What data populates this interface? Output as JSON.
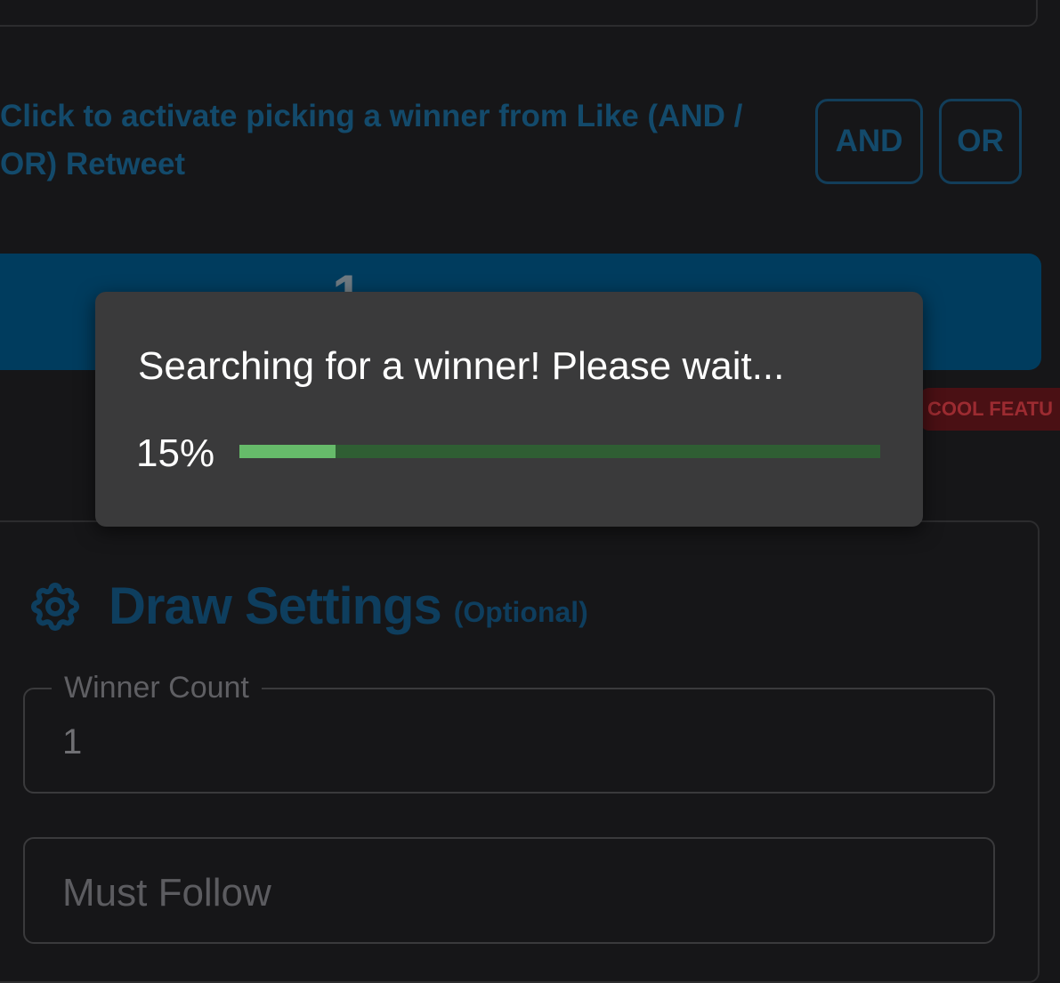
{
  "activation": {
    "text": "Click to activate picking a winner from Like (AND / OR) Retweet",
    "and_label": "AND",
    "or_label": "OR"
  },
  "pick_button": {
    "label": "1"
  },
  "badge": {
    "text": "COOL FEATU"
  },
  "loading": {
    "message": "Searching for a winner! Please wait...",
    "percent_label": "15%",
    "progress": 0.15,
    "colors": {
      "track": "#2f5e33",
      "fill": "#66bb6a"
    }
  },
  "draw_settings": {
    "title": "Draw Settings",
    "optional": "(Optional)",
    "icon": "gear-icon",
    "winner_count": {
      "label": "Winner Count",
      "value": "1"
    },
    "must_follow": {
      "placeholder": "Must Follow"
    }
  },
  "colors": {
    "background": "#161618",
    "accent_dim": "#134a6b",
    "primary_button": "#003c5e",
    "badge": "#4a1014"
  }
}
